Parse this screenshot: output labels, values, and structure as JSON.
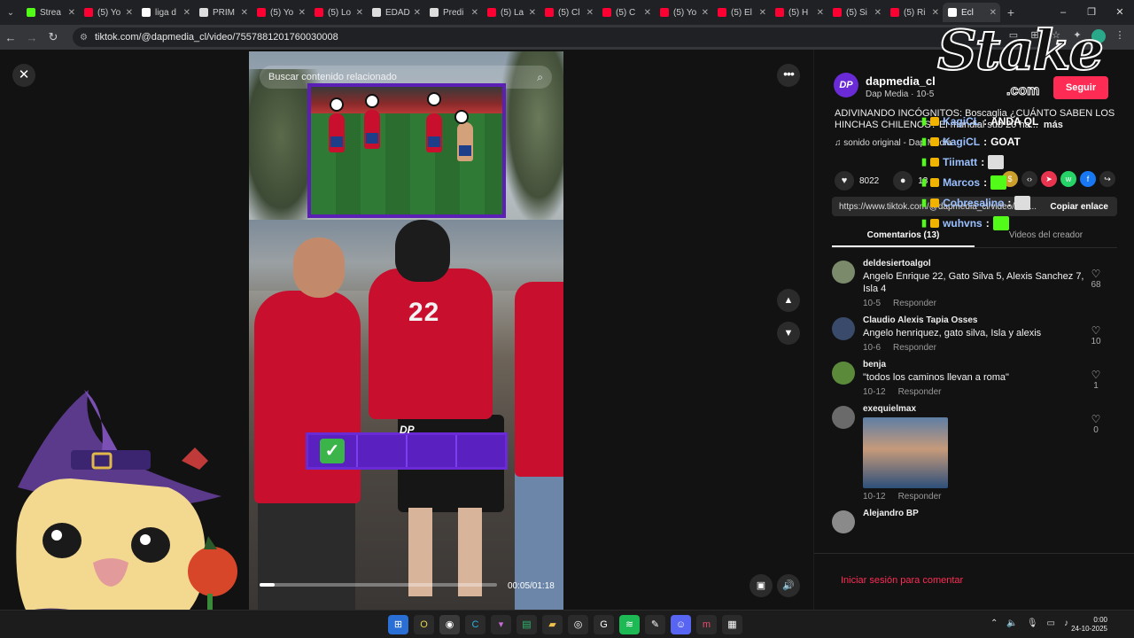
{
  "browser": {
    "tabs": [
      {
        "label": "Strea",
        "color": "#53fc18"
      },
      {
        "label": "(5) Yo",
        "color": "#ff0033"
      },
      {
        "label": "liga d",
        "color": "#ffffff"
      },
      {
        "label": "PRIM",
        "color": "#dddddd"
      },
      {
        "label": "(5) Yo",
        "color": "#ff0033"
      },
      {
        "label": "(5) Lo",
        "color": "#ff0033"
      },
      {
        "label": "EDAD",
        "color": "#dddddd"
      },
      {
        "label": "Predi",
        "color": "#dddddd"
      },
      {
        "label": "(5) La",
        "color": "#ff0033"
      },
      {
        "label": "(5) Cl",
        "color": "#ff0033"
      },
      {
        "label": "(5) C",
        "color": "#ff0033"
      },
      {
        "label": "(5) Yo",
        "color": "#ff0033"
      },
      {
        "label": "(5) El",
        "color": "#ff0033"
      },
      {
        "label": "(5) H",
        "color": "#ff0033"
      },
      {
        "label": "(5) Si",
        "color": "#ff0033"
      },
      {
        "label": "(5) Ri",
        "color": "#ff0033"
      },
      {
        "label": "Ecl",
        "color": "#ffffff",
        "active": true
      }
    ],
    "url": "tiktok.com/@dapmedia_cl/video/7557881201760030008"
  },
  "video": {
    "search_placeholder": "Buscar contenido relacionado",
    "jersey_number": "22",
    "overlay_logo": "DP",
    "check_mark": "✓",
    "time": "00:05/01:18",
    "progress": 0.064
  },
  "post": {
    "author": "dapmedia_cl",
    "subline": "Dap Media · 10-5",
    "avatar_text": "DP",
    "follow_label": "Seguir",
    "description": "ADIVINANDO INCÓGNITOS: Boscaglia ¿CUÁNTO SABEN LOS HINCHAS CHILENOS? El mundial sub 20 ha...",
    "more_label": "más",
    "sound": "sonido original - Dap Media",
    "likes": "8022",
    "comments_count": "13",
    "link": "https://www.tiktok.com/@dapmedia_cl/video/755...",
    "copy_label": "Copiar enlace",
    "tab_comments": "Comentarios (13)",
    "tab_videos": "Videos del creador"
  },
  "comments": [
    {
      "user": "deldesiertoalgol",
      "text": "Angelo Enrique 22, Gato Silva 5, Alexis Sanchez 7, Isla 4",
      "date": "10-5",
      "reply": "Responder",
      "likes": "68"
    },
    {
      "user": "Claudio Alexis Tapia Osses",
      "text": "Angelo henriquez, gato silva, Isla y alexis",
      "date": "10-6",
      "reply": "Responder",
      "likes": "10"
    },
    {
      "user": "benja",
      "text": "\"todos los caminos llevan a roma\"",
      "date": "10-12",
      "reply": "Responder",
      "likes": "1"
    },
    {
      "user": "exequielmax",
      "text": "",
      "date": "10-12",
      "reply": "Responder",
      "likes": "0",
      "has_image": true
    },
    {
      "user": "Alejandro BP",
      "text": "",
      "date": "",
      "reply": "",
      "likes": ""
    }
  ],
  "login_prompt": "Iniciar sesión para comentar",
  "overlay": {
    "brand": "Stake",
    "brand_suffix": ".com",
    "chat": [
      {
        "user": "KagiCL",
        "message": "ANDA QL"
      },
      {
        "user": "KagiCL",
        "message": "GOAT"
      },
      {
        "user": "Tiimatt",
        "message": ""
      },
      {
        "user": "Marcos",
        "message": ""
      },
      {
        "user": "Cobresalino",
        "message": ""
      },
      {
        "user": "wuhvns",
        "message": ""
      }
    ]
  },
  "taskbar": {
    "time": "0:00",
    "date": "24-10-2025"
  }
}
